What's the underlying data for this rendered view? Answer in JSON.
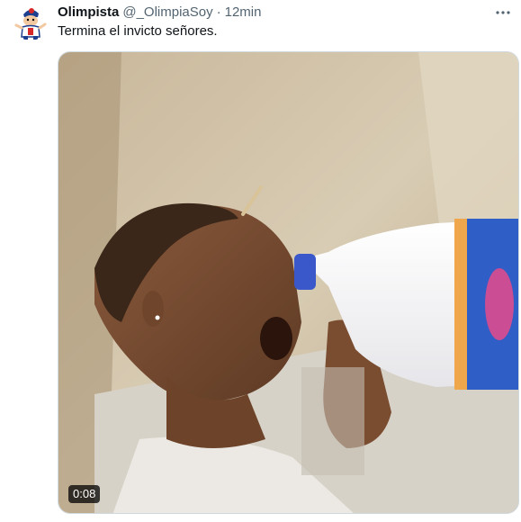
{
  "tweet": {
    "author_name": "Olimpista",
    "author_handle": "@_OlimpiaSoy",
    "separator": "·",
    "timestamp": "12min",
    "text": "Termina el invicto señores.",
    "more_icon": "more-options-icon",
    "video": {
      "duration": "0:08"
    }
  },
  "colors": {
    "text_primary": "#0f1419",
    "text_secondary": "#536471",
    "border": "#cfd9de"
  }
}
